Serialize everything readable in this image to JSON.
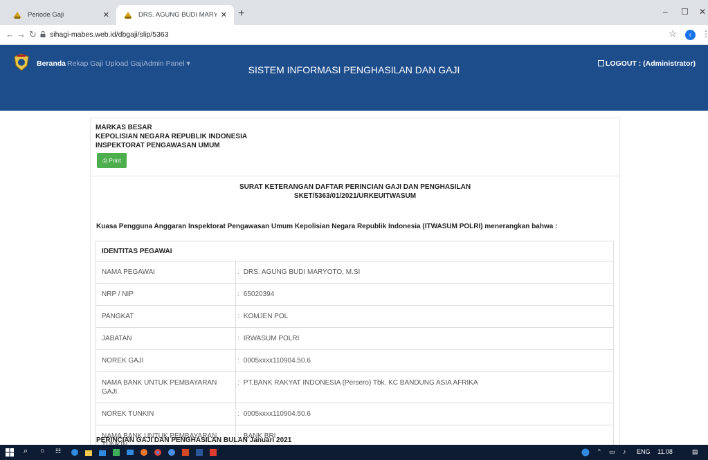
{
  "browser": {
    "tabs": [
      {
        "title": "Periode Gaji",
        "active": false
      },
      {
        "title": "DRS. AGUNG BUDI MARYOTO, M",
        "active": true
      }
    ],
    "url": "sihagi-mabes.web.id/dbgaji/slip/5363",
    "profile_initial": "r"
  },
  "nav": {
    "brand": "Beranda",
    "links": [
      "Rekap Gaji",
      "Upload Gaji",
      "Admin Panel ▾"
    ],
    "logout": "LOGOUT : (Administrator)",
    "system_name": "SISTEM INFORMASI PENGHASILAN DAN GAJI"
  },
  "document": {
    "org_lines": [
      "MARKAS BESAR",
      "KEPOLISIAN NEGARA REPUBLIK INDONESIA",
      "INSPEKTORAT PENGAWASAN UMUM"
    ],
    "print_label": "Print",
    "title": "SURAT KETERANGAN DAFTAR PERINCIAN GAJI DAN PENGHASILAN",
    "number": "SKET/5363/01/2021/URKEUITWASUM",
    "statement": "Kuasa Pengguna Anggaran Inspektorat Pengawasan Umum Kepolisian Negara Republik Indonesia (ITWASUM POLRI) menerangkan bahwa :",
    "identity_header": "IDENTITAS PEGAWAI",
    "identity": [
      {
        "label": "NAMA PEGAWAI",
        "value": "DRS. AGUNG BUDI MARYOTO, M.SI"
      },
      {
        "label": "NRP / NIP",
        "value": "65020394"
      },
      {
        "label": "PANGKAT",
        "value": "KOMJEN POL"
      },
      {
        "label": "JABATAN",
        "value": "IRWASUM POLRI"
      },
      {
        "label": "NOREK GAJI",
        "value": "0005xxxx110904.50.6"
      },
      {
        "label": "NAMA BANK UNTUK PEMBAYARAN GAJI",
        "value": "PT.BANK RAKYAT INDONESIA (Persero) Tbk. KC BANDUNG ASIA AFRIKA"
      },
      {
        "label": "NOREK TUNKIN",
        "value": "0005xxxx110904.50.6"
      },
      {
        "label": "NAMA BANK UNTUK PEMBAYARAN TUNKIN",
        "value": "BANK BRI"
      }
    ],
    "section2": "PERINCIAN GAJI DAN PENGHASILAN BULAN Januari 2021"
  },
  "taskbar": {
    "lang": "ENG",
    "time": "11.08"
  },
  "colors": {
    "navbar": "#1e4d8c",
    "print_button": "#4cae4c",
    "taskbar": "#0d1b33"
  }
}
